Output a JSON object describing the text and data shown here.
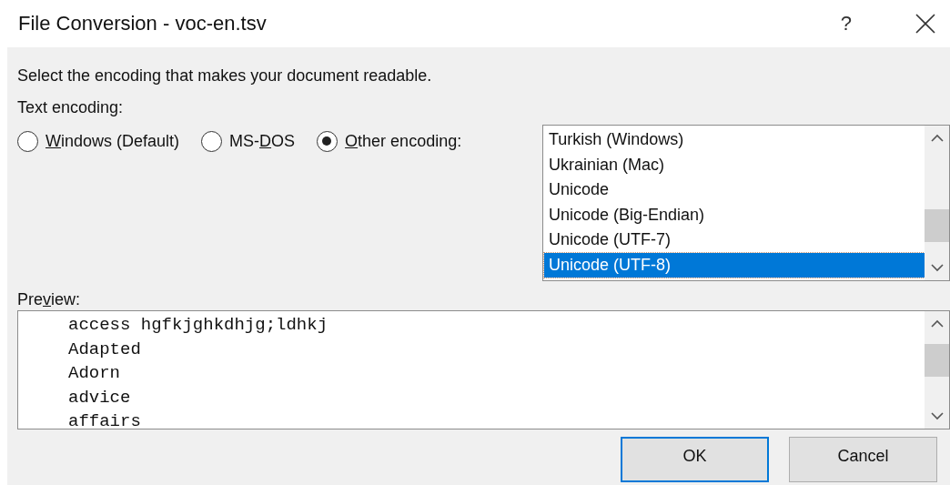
{
  "window": {
    "title": "File Conversion - voc-en.tsv",
    "help": "?"
  },
  "instruction": "Select the encoding that makes your document readable.",
  "text_encoding": {
    "label": "Text encoding:",
    "options": [
      {
        "key": "W",
        "after": "indows (Default)",
        "selected": false
      },
      {
        "before": "MS-",
        "key": "D",
        "after": "OS",
        "selected": false
      },
      {
        "key": "O",
        "after": "ther encoding:",
        "selected": true
      }
    ],
    "encodings": [
      {
        "label": "Turkish (Windows)",
        "selected": false
      },
      {
        "label": "Ukrainian (Mac)",
        "selected": false
      },
      {
        "label": "Unicode",
        "selected": false
      },
      {
        "label": "Unicode (Big-Endian)",
        "selected": false
      },
      {
        "label": "Unicode (UTF-7)",
        "selected": false
      },
      {
        "label": "Unicode (UTF-8)",
        "selected": true
      }
    ]
  },
  "preview": {
    "label": {
      "before": "Pre",
      "key": "v",
      "after": "iew:"
    },
    "lines": [
      "access hgfkjghkdhjg;ldhkj",
      "Adapted",
      "Adorn",
      "advice",
      "affairs"
    ]
  },
  "buttons": [
    {
      "label": "OK",
      "focused": true
    },
    {
      "label": "Cancel",
      "focused": false
    }
  ]
}
